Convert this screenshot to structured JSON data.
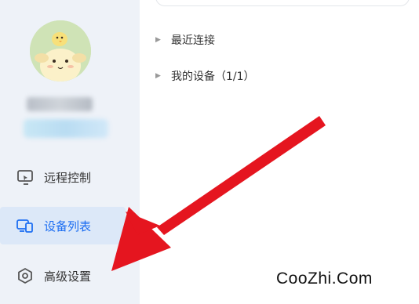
{
  "sidebar": {
    "items": [
      {
        "label": "远程控制",
        "icon": "remote-control-icon",
        "active": false
      },
      {
        "label": "设备列表",
        "icon": "device-list-icon",
        "active": true
      },
      {
        "label": "高级设置",
        "icon": "settings-icon",
        "active": false
      }
    ]
  },
  "main": {
    "tree": [
      {
        "label": "最近连接"
      },
      {
        "label": "我的设备（1/1）"
      }
    ]
  },
  "watermark": "CooZhi.Com",
  "colors": {
    "accent": "#1d6ef2",
    "sidebar_bg": "#eef2f8",
    "active_bg": "#dce8f8",
    "arrow": "#e5151f"
  }
}
